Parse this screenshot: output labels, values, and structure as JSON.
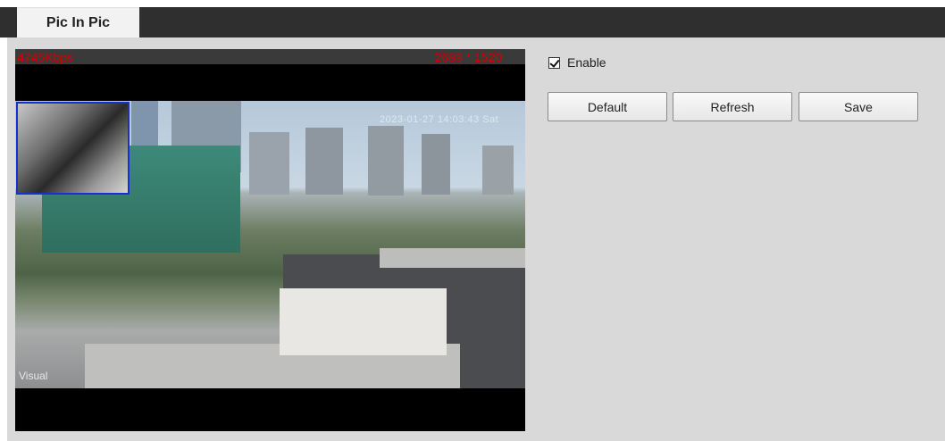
{
  "tab": {
    "label": "Pic In Pic"
  },
  "video": {
    "bitrate": "4745Kbps",
    "resolution": "2688 * 1520",
    "timestamp": "2023-01-27 14:03:43 Sat",
    "channel_label": "Visual"
  },
  "controls": {
    "enable_label": "Enable",
    "enable_checked": true,
    "default_label": "Default",
    "refresh_label": "Refresh",
    "save_label": "Save"
  },
  "colors": {
    "header_bar": "#2f2f2f",
    "content_bg": "#d9d9d9",
    "overlay_text": "#d40000",
    "pip_border": "#1a2fd1"
  }
}
